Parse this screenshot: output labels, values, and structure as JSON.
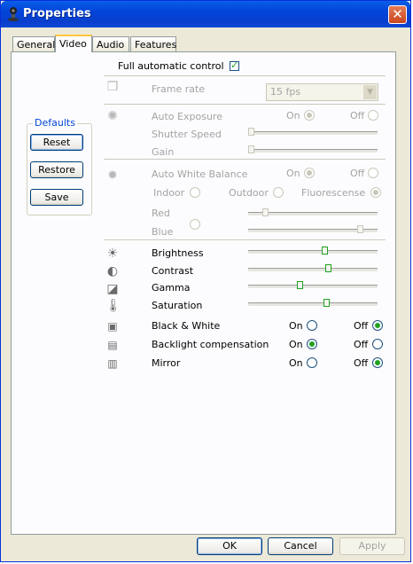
{
  "window": {
    "title": "Properties",
    "close_glyph": "✕"
  },
  "tabs": [
    {
      "label": "General"
    },
    {
      "label": "Video"
    },
    {
      "label": "Audio"
    },
    {
      "label": "Features"
    }
  ],
  "active_tab": "Video",
  "full_auto": {
    "label": "Full automatic control",
    "checked": true
  },
  "defaults": {
    "legend": "Defaults",
    "reset": "Reset",
    "restore": "Restore",
    "save": "Save"
  },
  "frame_rate": {
    "label": "Frame rate",
    "value": "15 fps",
    "arrow": "▼"
  },
  "exposure": {
    "auto_label": "Auto Exposure",
    "on": "On",
    "off": "Off",
    "selected": "On",
    "shutter_label": "Shutter Speed",
    "gain_label": "Gain"
  },
  "white_balance": {
    "auto_label": "Auto White Balance",
    "on": "On",
    "off": "Off",
    "selected": "On",
    "indoor": "Indoor",
    "outdoor": "Outdoor",
    "fluorescence": "Fluorescense",
    "mode_selected": "Fluorescense",
    "red_label": "Red",
    "blue_label": "Blue"
  },
  "sliders": [
    {
      "label": "Brightness",
      "icon": "brightness-icon"
    },
    {
      "label": "Contrast",
      "icon": "contrast-icon"
    },
    {
      "label": "Gamma",
      "icon": "gamma-icon"
    },
    {
      "label": "Saturation",
      "icon": "saturation-icon"
    }
  ],
  "toggles": [
    {
      "label": "Black & White",
      "on": "On",
      "off": "Off",
      "selected": "Off"
    },
    {
      "label": "Backlight compensation",
      "on": "On",
      "off": "Off",
      "selected": "On"
    },
    {
      "label": "Mirror",
      "on": "On",
      "off": "Off",
      "selected": "Off"
    }
  ],
  "footer": {
    "ok": "OK",
    "cancel": "Cancel",
    "apply": "Apply"
  }
}
